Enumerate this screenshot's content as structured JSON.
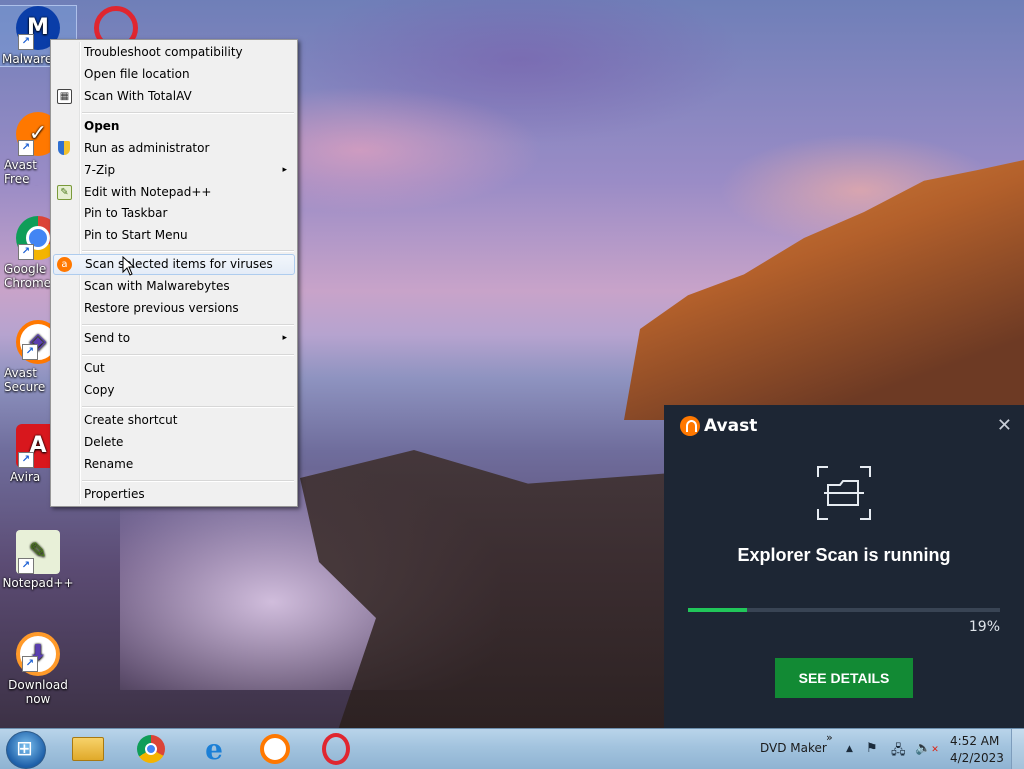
{
  "desktop": {
    "icons": [
      {
        "label": "Malwarebytes",
        "glyph": "M",
        "color": "#0a3da8"
      },
      {
        "label": "Avast Free Antivirus",
        "glyph": "✓",
        "color": "#ff7800"
      },
      {
        "label": "Google Chrome",
        "glyph": "◉",
        "color": "#34a853"
      },
      {
        "label": "Avast Secure Browser",
        "glyph": "◈",
        "color": "#ff7800"
      },
      {
        "label": "Avira",
        "glyph": "A",
        "color": "#d8171d"
      },
      {
        "label": "Notepad++",
        "glyph": "✎",
        "color": "#7aa43a"
      },
      {
        "label": "Download now",
        "glyph": "⬇",
        "color": "#ff7800"
      }
    ],
    "opera_icon": "O"
  },
  "context_menu": {
    "items": [
      {
        "label": "Troubleshoot compatibility"
      },
      {
        "label": "Open file location"
      },
      {
        "label": "Scan With TotalAV",
        "icon": "totalav-icon"
      },
      {
        "label": "Open"
      },
      {
        "label": "Run as administrator",
        "icon": "shield-icon"
      },
      {
        "label": "7-Zip",
        "submenu": "▸"
      },
      {
        "label": "Edit with Notepad++",
        "icon": "notepadpp-icon"
      },
      {
        "label": "Pin to Taskbar"
      },
      {
        "label": "Pin to Start Menu"
      },
      {
        "label": "Scan selected items for viruses",
        "icon": "avast-icon"
      },
      {
        "label": "Scan with Malwarebytes"
      },
      {
        "label": "Restore previous versions"
      },
      {
        "label": "Send to",
        "submenu": "▸"
      },
      {
        "label": "Cut"
      },
      {
        "label": "Copy"
      },
      {
        "label": "Create shortcut"
      },
      {
        "label": "Delete"
      },
      {
        "label": "Rename"
      },
      {
        "label": "Properties"
      }
    ]
  },
  "avast_popup": {
    "brand": "Avast",
    "close_glyph": "✕",
    "title": "Explorer Scan is running",
    "progress": 0.19,
    "progress_label": "19%",
    "button_label": "SEE DETAILS",
    "accent": "#21c65a",
    "button_color": "#128a34"
  },
  "taskbar": {
    "apps": [
      "file-explorer-icon",
      "chrome-icon",
      "internet-explorer-icon",
      "avast-browser-icon",
      "opera-icon"
    ],
    "toolbar_label": "DVD Maker",
    "toolbar_chevron": "»",
    "tray_arrow": "▲",
    "time": "4:52 AM",
    "date": "4/2/2023"
  }
}
